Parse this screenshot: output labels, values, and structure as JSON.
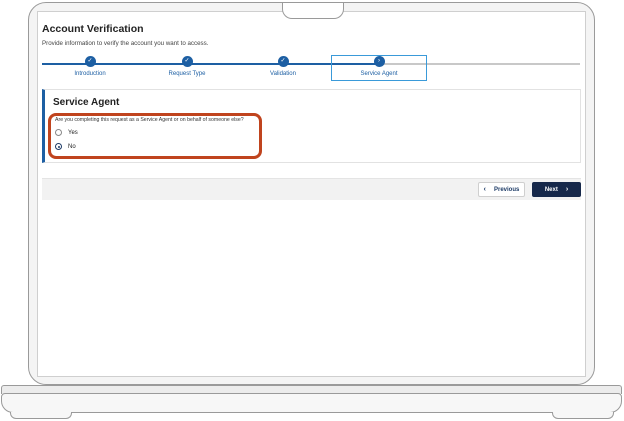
{
  "page": {
    "title": "Account Verification",
    "subtitle": "Provide information to verify the account you want to access."
  },
  "stepper": {
    "steps": [
      {
        "label": "Introduction",
        "icon": "check-icon",
        "status": "complete"
      },
      {
        "label": "Request Type",
        "icon": "check-icon",
        "status": "complete"
      },
      {
        "label": "Validation",
        "icon": "check-icon",
        "status": "complete"
      },
      {
        "label": "Service Agent",
        "icon": "chevron-right-icon",
        "status": "current"
      }
    ]
  },
  "section": {
    "title": "Service Agent",
    "question": "Are you completing this request as a Service Agent or on behalf of someone else?",
    "options": [
      {
        "label": "Yes",
        "selected": false
      },
      {
        "label": "No",
        "selected": true
      }
    ]
  },
  "nav": {
    "previous_label": "Previous",
    "next_label": "Next"
  },
  "colors": {
    "accent": "#1d5fa3",
    "primary_button": "#16284a",
    "highlight": "#c0441e"
  }
}
